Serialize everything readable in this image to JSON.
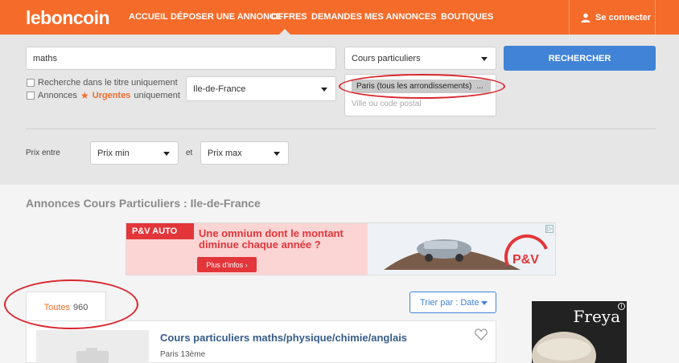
{
  "header": {
    "logo": "leboncoin",
    "nav": [
      "ACCUEIL",
      "DÉPOSER UNE ANNONCE",
      "OFFRES",
      "DEMANDES",
      "MES ANNONCES",
      "BOUTIQUES"
    ],
    "active_nav": "OFFRES",
    "connect_label": "Se connecter"
  },
  "search": {
    "query": "maths",
    "category": "Cours particuliers",
    "submit_label": "RECHERCHER",
    "title_only_label": "Recherche dans le titre uniquement",
    "urgent_prefix": "Annonces",
    "urgent_word": "Urgentes",
    "urgent_suffix": "uniquement",
    "region": "Ile-de-France",
    "location_chip": "Paris (tous les arrondissements)",
    "location_chip_more": "...",
    "location_placeholder": "Ville ou code postal",
    "price_label": "Prix entre",
    "price_min": "Prix min",
    "price_and": "et",
    "price_max": "Prix max"
  },
  "results": {
    "title": "Annonces Cours Particuliers : Ile-de-France",
    "tab_all_label": "Toutes",
    "tab_all_count": "960",
    "sort_label": "Trier par : Date",
    "listing": {
      "title": "Cours particuliers maths/physique/chimie/anglais",
      "location": "Paris 13ème"
    }
  },
  "ad": {
    "brand": "P&V AUTO",
    "headline_line1": "Une omnium dont le montant",
    "headline_line2": "diminue chaque année ?",
    "cta": "Plus d'infos ›",
    "logo_text": "P&V"
  },
  "side_ad": {
    "brand": "Freya"
  },
  "colors": {
    "brand": "#f56b2a",
    "accent": "#4183d7",
    "annotation": "#d9262e"
  }
}
